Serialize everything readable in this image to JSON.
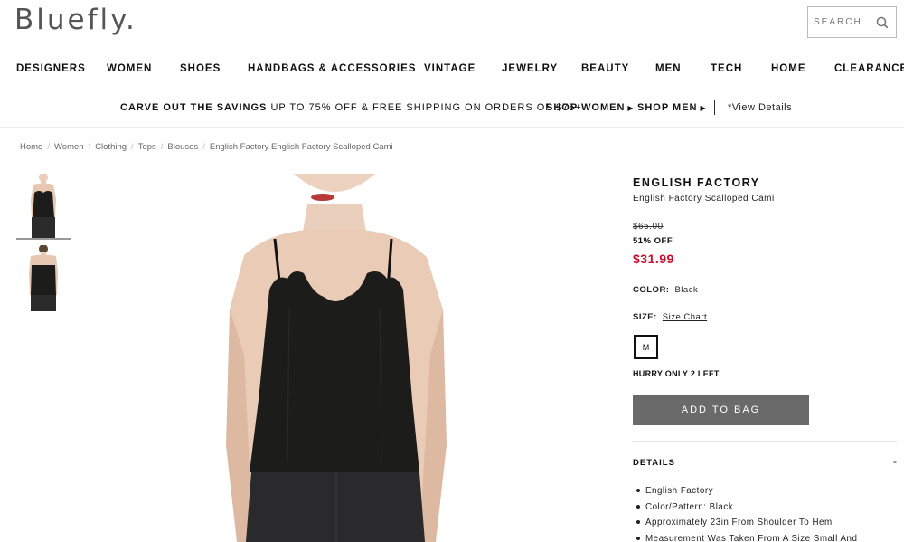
{
  "header": {
    "logo": "Bluefly.",
    "search_label": "SEARCH"
  },
  "nav": {
    "items": [
      "DESIGNERS",
      "WOMEN",
      "SHOES",
      "HANDBAGS & ACCESSORIES",
      "VINTAGE",
      "JEWELRY",
      "BEAUTY",
      "MEN",
      "TECH",
      "HOME",
      "CLEARANCE"
    ]
  },
  "promo": {
    "headline": "CARVE OUT THE SAVINGS",
    "text": "UP TO 75% OFF & FREE SHIPPING ON ORDERS OF $75+",
    "shop_women": "SHOP WOMEN",
    "shop_men": "SHOP MEN",
    "details": "*View Details"
  },
  "breadcrumb": [
    "Home",
    "Women",
    "Clothing",
    "Tops",
    "Blouses",
    "English Factory English Factory Scalloped Cami"
  ],
  "product": {
    "brand": "ENGLISH FACTORY",
    "name": "English Factory Scalloped Cami",
    "original_price": "$65.00",
    "discount": "51% OFF",
    "price": "$31.99",
    "color_label": "COLOR:",
    "color_value": "Black",
    "size_label": "SIZE:",
    "size_chart": "Size Chart",
    "sizes": [
      "M"
    ],
    "stock_note": "HURRY ONLY 2 LEFT",
    "add_to_bag": "ADD TO BAG",
    "details_title": "DETAILS",
    "details_toggle": "-",
    "details": [
      "English Factory",
      "Color/Pattern: Black",
      "Approximately 23in From Shoulder To Hem",
      "Measurement Was Taken From A Size Small And"
    ]
  },
  "colors": {
    "price_red": "#c8102e",
    "button_gray": "#6a6a6a",
    "garment": "#1c1c1a"
  },
  "icons": {
    "search": "search-icon",
    "caret": "caret-right-icon"
  }
}
